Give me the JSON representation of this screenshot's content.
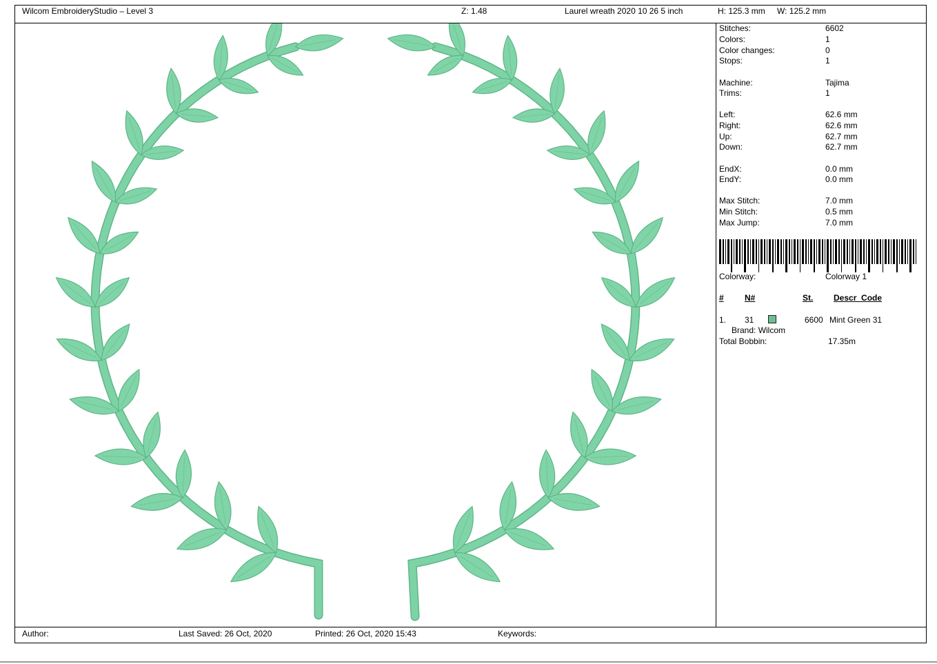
{
  "header": {
    "app_title": "Wilcom EmbroideryStudio – Level 3",
    "zoom": "Z: 1.48",
    "design_name": "Laurel wreath 2020 10 26 5 inch",
    "height": "H: 125.3 mm",
    "width": "W: 125.2 mm"
  },
  "stats": {
    "stitches": {
      "label": "Stitches:",
      "value": "6602"
    },
    "colors": {
      "label": "Colors:",
      "value": "1"
    },
    "color_changes": {
      "label": "Color changes:",
      "value": "0"
    },
    "stops": {
      "label": "Stops:",
      "value": "1"
    },
    "machine": {
      "label": "Machine:",
      "value": "Tajima"
    },
    "trims": {
      "label": "Trims:",
      "value": "1"
    },
    "left": {
      "label": "Left:",
      "value": "62.6 mm"
    },
    "right": {
      "label": "Right:",
      "value": "62.6 mm"
    },
    "up": {
      "label": "Up:",
      "value": "62.7 mm"
    },
    "down": {
      "label": "Down:",
      "value": "62.7 mm"
    },
    "endx": {
      "label": "EndX:",
      "value": "0.0 mm"
    },
    "endy": {
      "label": "EndY:",
      "value": "0.0 mm"
    },
    "max_stitch": {
      "label": "Max Stitch:",
      "value": "7.0 mm"
    },
    "min_stitch": {
      "label": "Min Stitch:",
      "value": "0.5 mm"
    },
    "max_jump": {
      "label": "Max Jump:",
      "value": "7.0 mm"
    },
    "colorway": {
      "label": "Colorway:",
      "value": "Colorway 1"
    }
  },
  "color_table": {
    "headers": [
      "#",
      "N#",
      "St.",
      "Descr_Code"
    ],
    "rows": [
      {
        "index": "1.",
        "number": "31",
        "swatch_color": "#6cbf93",
        "stitches": "6600",
        "description": "Mint Green 31",
        "brand": "Brand: Wilcom"
      }
    ],
    "total_bobbin_label": "Total Bobbin:",
    "total_bobbin_value": "17.35m"
  },
  "footer": {
    "author": "Author:",
    "last_saved": "Last Saved: 26 Oct, 2020",
    "printed": "Printed: 26 Oct, 2020 15:43",
    "keywords": "Keywords:"
  },
  "design": {
    "thread_color": "#7dd3a5",
    "shadow_color": "#5fb587",
    "highlight_color": "#a8e6c4"
  }
}
